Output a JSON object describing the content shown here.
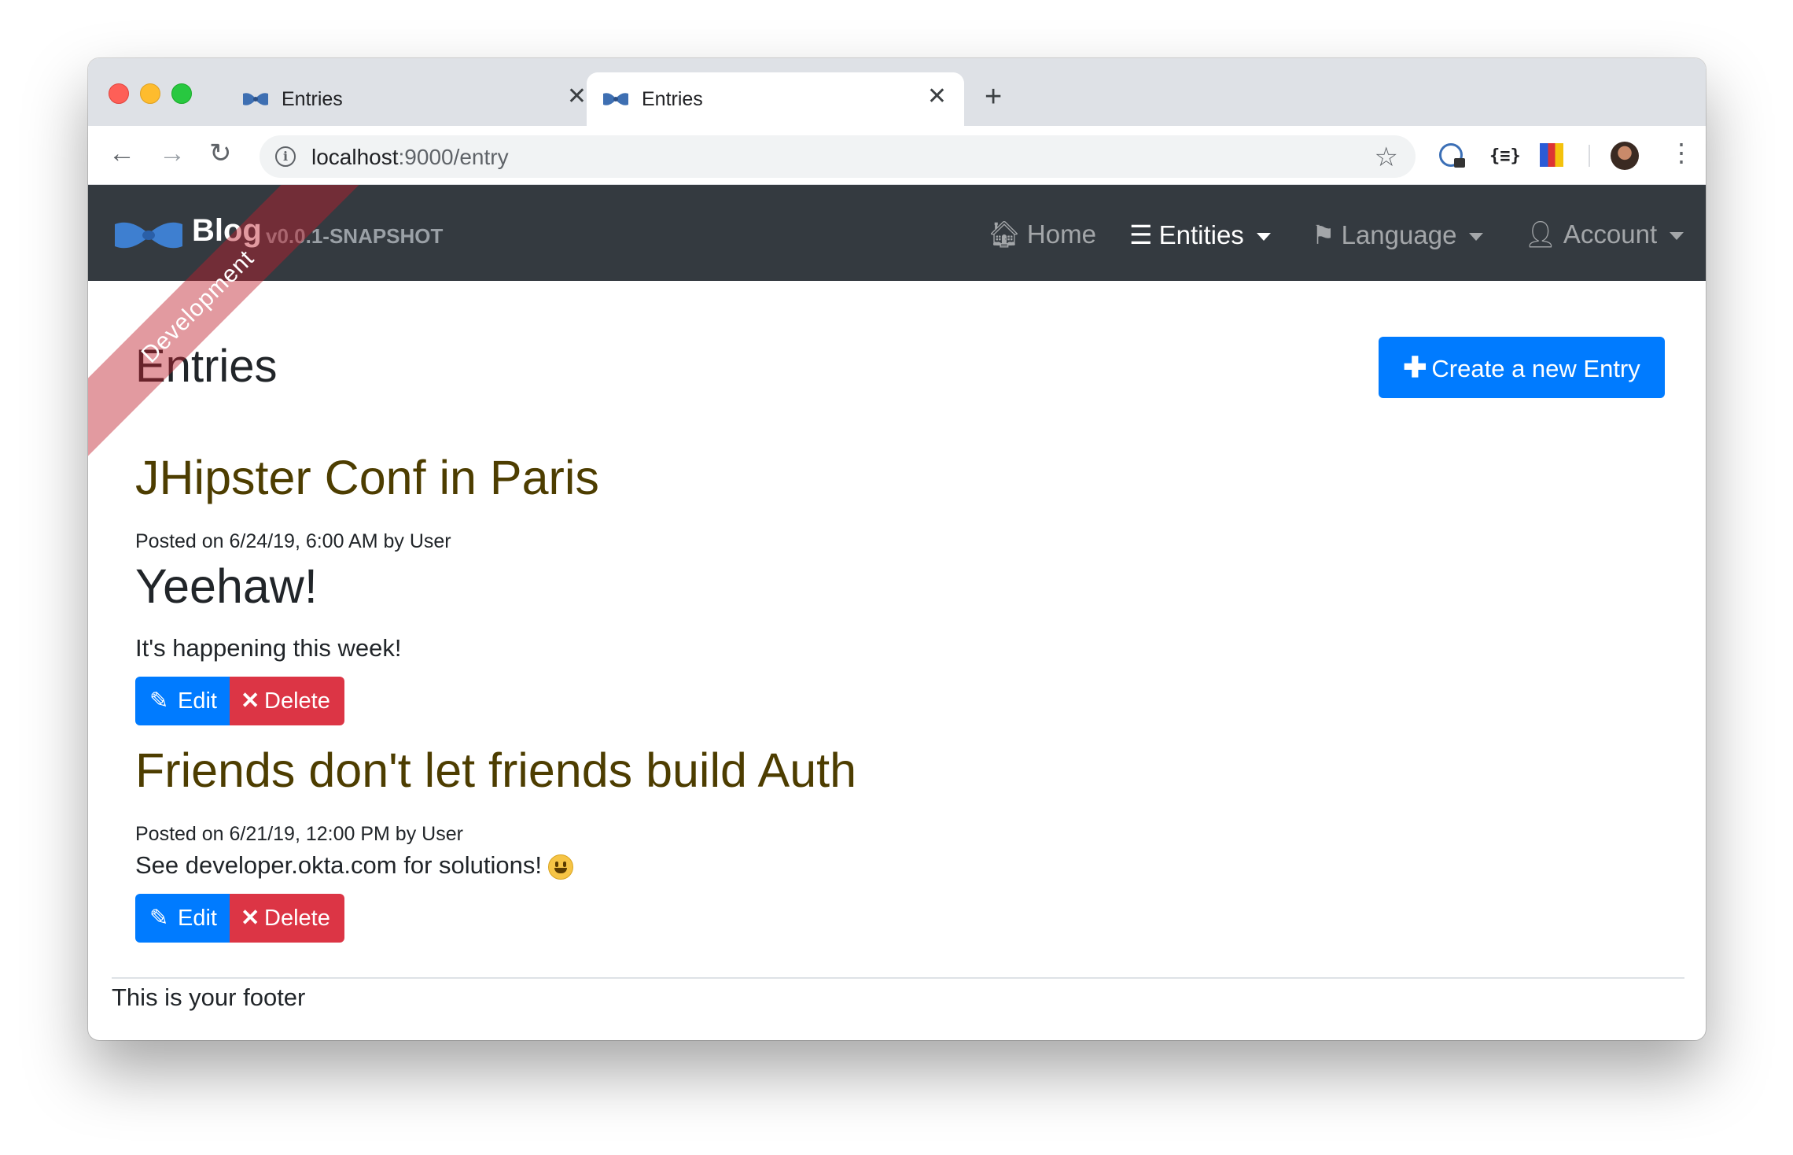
{
  "browser": {
    "tabs": [
      {
        "title": "Entries",
        "active": false
      },
      {
        "title": "Entries",
        "active": true
      }
    ],
    "url_host": "localhost",
    "url_rest": ":9000/entry",
    "extension_2_label": "{≡}"
  },
  "navbar": {
    "brand": "Blog",
    "version": "v0.0.1-SNAPSHOT",
    "ribbon": "Development",
    "items": [
      {
        "label": "Home",
        "icon": "home-icon",
        "active": false
      },
      {
        "label": "Entities",
        "icon": "list-icon",
        "active": true
      },
      {
        "label": "Language",
        "icon": "flag-icon",
        "active": false
      },
      {
        "label": "Account",
        "icon": "user-icon",
        "active": false
      }
    ]
  },
  "page": {
    "title": "Entries",
    "create_button": "Create a new Entry"
  },
  "entries": [
    {
      "title": "JHipster Conf in Paris",
      "meta": "Posted on 6/24/19, 6:00 AM by User",
      "heading": "Yeehaw!",
      "body": "It's happening this week!",
      "edit_label": "Edit",
      "delete_label": "Delete"
    },
    {
      "title": "Friends don't let friends build Auth",
      "meta": "Posted on 6/21/19, 12:00 PM by User",
      "body": "See developer.okta.com for solutions!",
      "edit_label": "Edit",
      "delete_label": "Delete"
    }
  ],
  "footer": "This is your footer",
  "colors": {
    "primary": "#007bff",
    "danger": "#dc3545",
    "navbar": "#343a40",
    "entry_title": "#4d3d00"
  }
}
